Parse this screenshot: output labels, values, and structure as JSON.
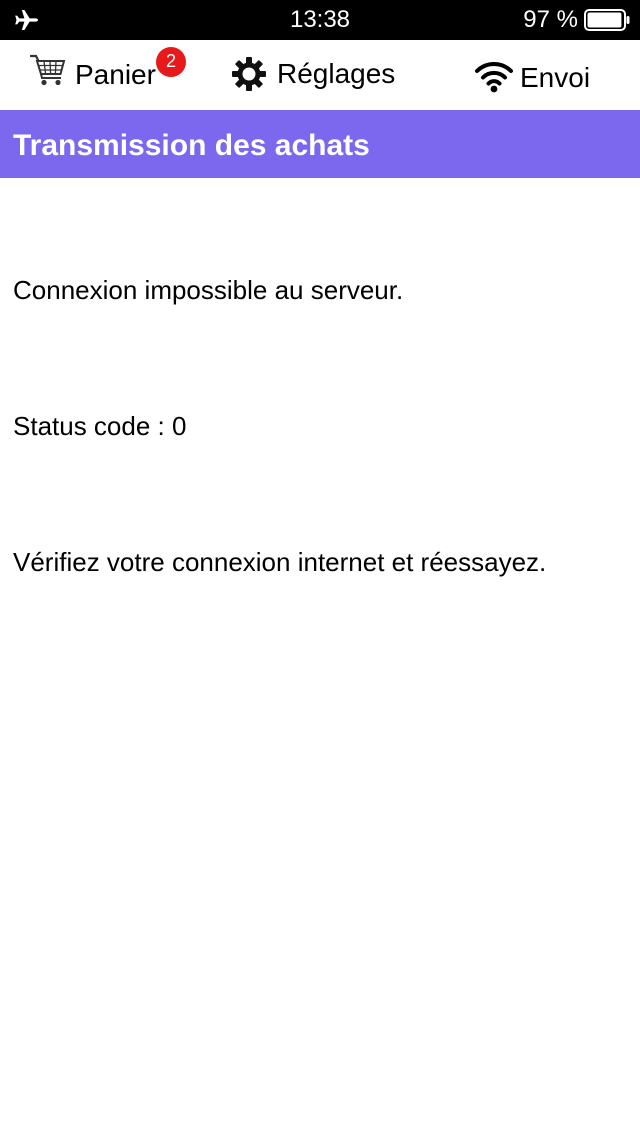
{
  "status_bar": {
    "time": "13:38",
    "battery_text": "97 %",
    "battery_level": 0.97,
    "icons": [
      "airplane-icon",
      "battery-icon"
    ]
  },
  "tabs": [
    {
      "label": "Panier",
      "icon": "cart-icon",
      "badge": "2"
    },
    {
      "label": "Réglages",
      "icon": "gear-icon"
    },
    {
      "label": "Envoi",
      "icon": "wifi-icon"
    }
  ],
  "header": {
    "title": "Transmission des achats"
  },
  "messages": [
    "Connexion impossible au serveur.",
    "Status code : 0",
    "Vérifiez votre connexion internet et réessayez."
  ],
  "colors": {
    "header_bg": "#7b68ee",
    "badge_bg": "#e8191a",
    "status_bar_bg": "#000000"
  }
}
